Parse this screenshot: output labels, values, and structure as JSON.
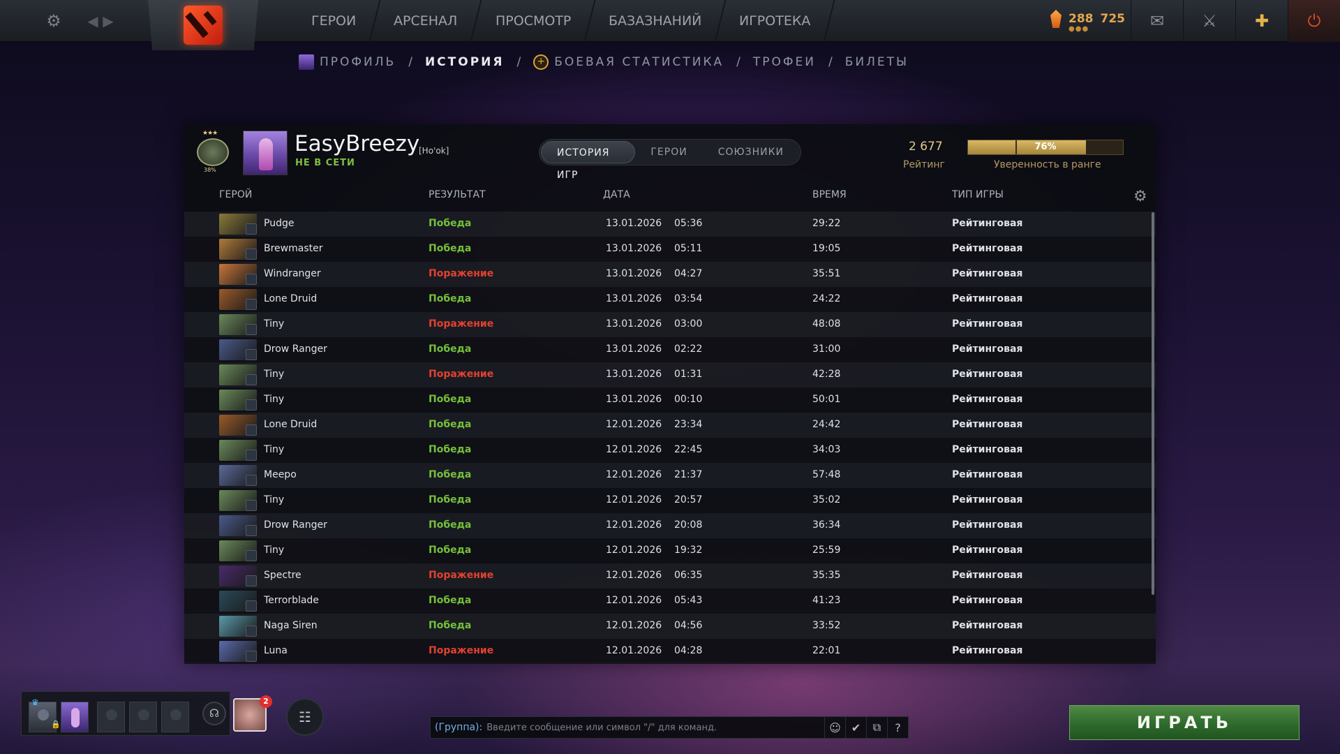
{
  "topbar": {
    "nav": [
      "ГЕРОИ",
      "АРСЕНАЛ",
      "ПРОСМОТР",
      "БАЗАЗНАНИЙ",
      "ИГРОТЕКА"
    ],
    "shards": "288",
    "level": "725",
    "shard_dots": "●●●"
  },
  "subnav": {
    "profile": "ПРОФИЛЬ",
    "history": "ИСТОРИЯ",
    "stats": "БОЕВАЯ СТАТИСТИКА",
    "trophies": "ТРОФЕИ",
    "tickets": "БИЛЕТЫ",
    "sep": "/"
  },
  "player": {
    "name": "EasyBreezy",
    "tag": "[Ho'ok]",
    "status": "НЕ В СЕТИ",
    "medal_stars": "★★★",
    "medal_pct": "38%"
  },
  "tabs": [
    "ИСТОРИЯ ИГР",
    "ГЕРОИ",
    "СОЮЗНИКИ"
  ],
  "rating": {
    "value": "2 677",
    "label": "Рейтинг",
    "confidence": "76%",
    "confidence_fraction": 0.76,
    "confidence_label": "Уверенность в ранге"
  },
  "table": {
    "headers": {
      "hero": "ГЕРОЙ",
      "result": "РЕЗУЛЬТАТ",
      "date": "ДАТА",
      "duration": "ВРЕМЯ",
      "type": "ТИП ИГРЫ"
    },
    "rows": [
      {
        "hero": "Pudge",
        "result": "Победа",
        "win": true,
        "date": "13.01.2026",
        "time": "05:36",
        "duration": "29:22",
        "type": "Рейтинговая",
        "color": "#8a7a3a"
      },
      {
        "hero": "Brewmaster",
        "result": "Победа",
        "win": true,
        "date": "13.01.2026",
        "time": "05:11",
        "duration": "19:05",
        "type": "Рейтинговая",
        "color": "#b07a3a"
      },
      {
        "hero": "Windranger",
        "result": "Поражение",
        "win": false,
        "date": "13.01.2026",
        "time": "04:27",
        "duration": "35:51",
        "type": "Рейтинговая",
        "color": "#c8763a"
      },
      {
        "hero": "Lone Druid",
        "result": "Победа",
        "win": true,
        "date": "13.01.2026",
        "time": "03:54",
        "duration": "24:22",
        "type": "Рейтинговая",
        "color": "#9a5a2a"
      },
      {
        "hero": "Tiny",
        "result": "Поражение",
        "win": false,
        "date": "13.01.2026",
        "time": "03:00",
        "duration": "48:08",
        "type": "Рейтинговая",
        "color": "#6a8a5a"
      },
      {
        "hero": "Drow Ranger",
        "result": "Победа",
        "win": true,
        "date": "13.01.2026",
        "time": "02:22",
        "duration": "31:00",
        "type": "Рейтинговая",
        "color": "#4a5a8a"
      },
      {
        "hero": "Tiny",
        "result": "Поражение",
        "win": false,
        "date": "13.01.2026",
        "time": "01:31",
        "duration": "42:28",
        "type": "Рейтинговая",
        "color": "#6a8a5a"
      },
      {
        "hero": "Tiny",
        "result": "Победа",
        "win": true,
        "date": "13.01.2026",
        "time": "00:10",
        "duration": "50:01",
        "type": "Рейтинговая",
        "color": "#6a8a5a"
      },
      {
        "hero": "Lone Druid",
        "result": "Победа",
        "win": true,
        "date": "12.01.2026",
        "time": "23:34",
        "duration": "24:42",
        "type": "Рейтинговая",
        "color": "#9a5a2a"
      },
      {
        "hero": "Tiny",
        "result": "Победа",
        "win": true,
        "date": "12.01.2026",
        "time": "22:45",
        "duration": "34:03",
        "type": "Рейтинговая",
        "color": "#6a8a5a"
      },
      {
        "hero": "Meepo",
        "result": "Победа",
        "win": true,
        "date": "12.01.2026",
        "time": "21:37",
        "duration": "57:48",
        "type": "Рейтинговая",
        "color": "#5a6a9a"
      },
      {
        "hero": "Tiny",
        "result": "Победа",
        "win": true,
        "date": "12.01.2026",
        "time": "20:57",
        "duration": "35:02",
        "type": "Рейтинговая",
        "color": "#6a8a5a"
      },
      {
        "hero": "Drow Ranger",
        "result": "Победа",
        "win": true,
        "date": "12.01.2026",
        "time": "20:08",
        "duration": "36:34",
        "type": "Рейтинговая",
        "color": "#4a5a8a"
      },
      {
        "hero": "Tiny",
        "result": "Победа",
        "win": true,
        "date": "12.01.2026",
        "time": "19:32",
        "duration": "25:59",
        "type": "Рейтинговая",
        "color": "#6a8a5a"
      },
      {
        "hero": "Spectre",
        "result": "Поражение",
        "win": false,
        "date": "12.01.2026",
        "time": "06:35",
        "duration": "35:35",
        "type": "Рейтинговая",
        "color": "#4a2a6a"
      },
      {
        "hero": "Terrorblade",
        "result": "Победа",
        "win": true,
        "date": "12.01.2026",
        "time": "05:43",
        "duration": "41:23",
        "type": "Рейтинговая",
        "color": "#2a4a5a"
      },
      {
        "hero": "Naga Siren",
        "result": "Победа",
        "win": true,
        "date": "12.01.2026",
        "time": "04:56",
        "duration": "33:52",
        "type": "Рейтинговая",
        "color": "#5a9aaa"
      },
      {
        "hero": "Luna",
        "result": "Поражение",
        "win": false,
        "date": "12.01.2026",
        "time": "04:28",
        "duration": "22:01",
        "type": "Рейтинговая",
        "color": "#5a6aaa"
      }
    ]
  },
  "bottom": {
    "notif_count": "2",
    "chat_channel": "(Группа):",
    "chat_placeholder": "Введите сообщение или символ \"/\" для команд.",
    "play": "ИГРАТЬ",
    "help": "?"
  },
  "colors": {
    "win": "#74c03a",
    "loss": "#e2412f",
    "accent_gold": "#e3a64f",
    "play_green": "#2e6a2c"
  }
}
